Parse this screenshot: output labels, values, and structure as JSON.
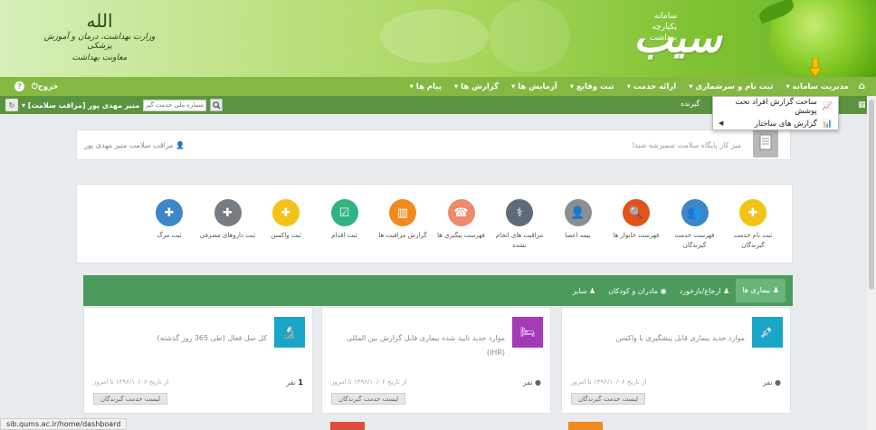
{
  "header": {
    "ministry_emblem": "الله",
    "ministry_line1": "وزارت بهداشت، درمان و آموزش پزشکی",
    "ministry_line2": "معاونت بهداشت",
    "brand_line1": "سامانه",
    "brand_line2": "یکپارچه",
    "brand_line3": "بهداشت",
    "logo_text": "سیب"
  },
  "nav": {
    "items": [
      {
        "label": "مدیریت سامانه ▾"
      },
      {
        "label": "ثبت نام و سرشماری ▾"
      },
      {
        "label": "ارائه خدمت ▾"
      },
      {
        "label": "ثبت وقایع ▾"
      },
      {
        "label": "آزمایش ها ▾"
      },
      {
        "label": "گزارش ها ▾"
      },
      {
        "label": "پیام ها ▾"
      }
    ],
    "exit_label": "خروج",
    "help_label": "?"
  },
  "subbar": {
    "user_badge": "منیر مهدی پور [مراقب سلامت] ▾",
    "search_placeholder": "شماره ملی خدمت گیرنده",
    "partial_text": "گیرنده"
  },
  "dropdown": {
    "items": [
      {
        "label": "ساخت گزارش افراد تحت پوشش"
      },
      {
        "label": "گزارش های ساختار"
      }
    ]
  },
  "dashboard": {
    "title": "میز کار پایگاه سلامت شمیرشه شیدا",
    "user_label": "مراقب سلامت منیر مهدی پور"
  },
  "shortcuts": [
    {
      "label": "ثبت نام خدمت گیرندگان",
      "color": "#f3c318"
    },
    {
      "label": "فهرست خدمت گیرندگان",
      "color": "#3d86c8"
    },
    {
      "label": "فهرست خانوار ها",
      "color": "#e0531c"
    },
    {
      "label": "بیمه اعضا",
      "color": "#8a8f92"
    },
    {
      "label": "مراقبت های انجام نشده",
      "color": "#5e6b78"
    },
    {
      "label": "فهرست پیگیری ها",
      "color": "#ee8b6d"
    },
    {
      "label": "گزارش مراقبت ها",
      "color": "#f08a1c"
    },
    {
      "label": "ثبت اقدام",
      "color": "#2fb380"
    },
    {
      "label": "ثبت واکسن",
      "color": "#f3c318"
    },
    {
      "label": "ثبت داروهای مصرفی",
      "color": "#767c80"
    },
    {
      "label": "ثبت مرگ",
      "color": "#3d86c8"
    }
  ],
  "tabs": [
    {
      "label": "بیماری ها"
    },
    {
      "label": "ارجاع/بازخورد"
    },
    {
      "label": "مادران و کودکان"
    },
    {
      "label": "سایر"
    }
  ],
  "cards": [
    {
      "title": "موارد جدید بیماری قابل پیشگیری با واکسن",
      "count_label": "نفر",
      "date_range": "از تاریخ ۱۳۹۶/۱۰/۰۶ تا امروز",
      "button": "لیست خدمت گیرندگان",
      "icon_color": "#1aa6c9"
    },
    {
      "title": "موارد جدید تایید شده بیماری قابل گزارش بین المللی (IHR)",
      "count_label": "نفر",
      "date_range": "از تاریخ ۱۳۹۶/۱۰/۰۶ تا امروز",
      "button": "لیست خدمت گیرندگان",
      "icon_color": "#a33bb8"
    },
    {
      "title": "کل سل فعال (طی 365 روز گذشته)",
      "count_value": "1",
      "count_label": "نفر",
      "date_range": "از تاریخ ۱۳۹۶/۱۰/۰۶ تا امروز",
      "button": "لیست خدمت گیرندگان",
      "icon_color": "#1aa6c9"
    }
  ],
  "status_url": "sib.qums.ac.ir/home/dashboard"
}
